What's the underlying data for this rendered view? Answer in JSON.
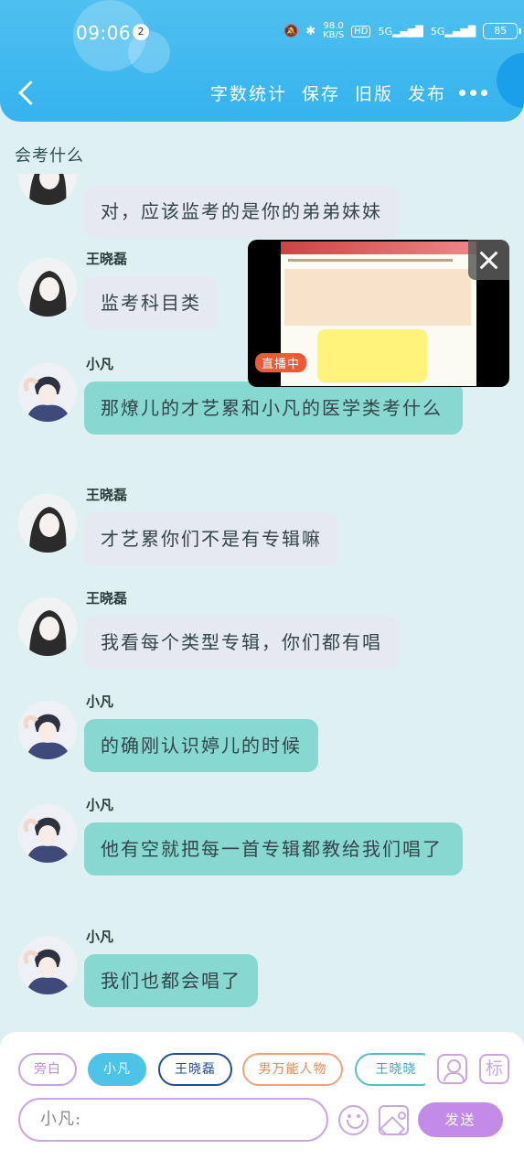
{
  "status_bar": {
    "time": "09:06",
    "notification_count": "2",
    "net_speed_value": "98.0",
    "net_speed_unit": "KB/S",
    "hd_label": "HD",
    "signal_1": "5G",
    "signal_2": "5G",
    "battery": "85"
  },
  "toolbar": {
    "word_count": "字数统计",
    "save": "保存",
    "old_version": "旧版",
    "publish": "发布"
  },
  "chat_title": "会考什么",
  "messages": [
    {
      "sender": "",
      "text": "对，应该监考的是你的弟弟妹妹",
      "style": "grey"
    },
    {
      "sender": "王晓磊",
      "text": "监考科目类",
      "style": "grey"
    },
    {
      "sender": "小凡",
      "text": "那燎儿的才艺累和小凡的医学类考什么",
      "style": "teal"
    },
    {
      "sender": "王晓磊",
      "text": "才艺累你们不是有专辑嘛",
      "style": "grey"
    },
    {
      "sender": "王晓磊",
      "text": "我看每个类型专辑，你们都有唱",
      "style": "grey"
    },
    {
      "sender": "小凡",
      "text": "的确刚认识婷儿的时候",
      "style": "teal"
    },
    {
      "sender": "小凡",
      "text": "他有空就把每一首专辑都教给我们唱了",
      "style": "teal"
    },
    {
      "sender": "小凡",
      "text": "我们也都会唱了",
      "style": "teal"
    }
  ],
  "video": {
    "live_label": "直播中"
  },
  "characters": [
    "旁白",
    "小凡",
    "王晓磊",
    "男万能人物",
    "王晓晓"
  ],
  "input": {
    "value": "小凡:"
  },
  "mark_icon_label": "标",
  "send_label": "发送",
  "colors": {
    "header": "#34b3ee",
    "chat_bg": "#dff0f2",
    "bubble_grey": "#e6e9ef",
    "bubble_teal": "#86d8d1",
    "accent": "#c48ae8"
  }
}
